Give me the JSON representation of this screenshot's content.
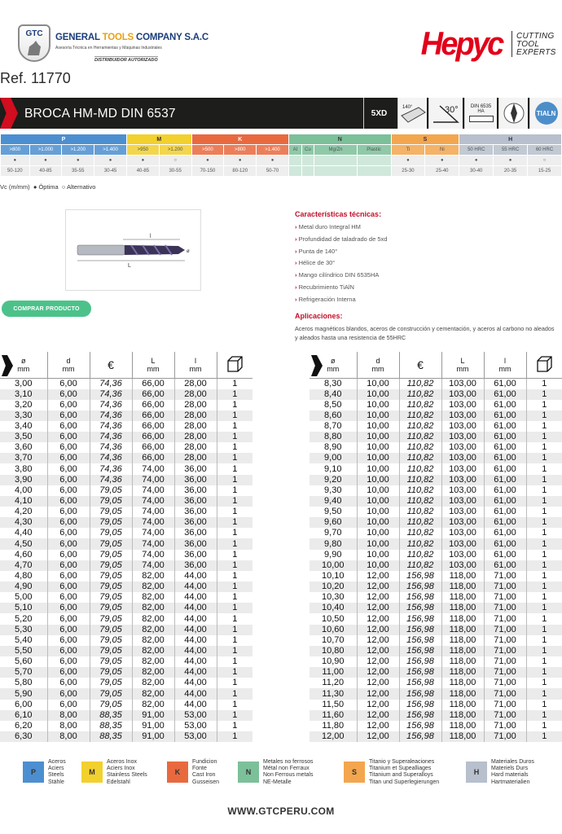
{
  "header": {
    "company_logo_text": "GTC",
    "company_name_a": "GENERAL",
    "company_name_b": "TOOLS",
    "company_name_c": "COMPANY S.A.C",
    "company_sub": "Asesoría Técnica en Herramientas y Máquinas Industriales",
    "distributor": "DISTRIBUIDOR AUTORIZADO",
    "brand": "Hepyc",
    "brand_tag": [
      "CUTTING",
      "TOOL",
      "EXPERTS"
    ],
    "ref": "Ref. 11770"
  },
  "product": {
    "title": "BROCA HM-MD DIN 6537",
    "icons": {
      "depth": "5XD",
      "point": "140°",
      "helix": "30°",
      "shank": "DIN 6535 HA",
      "coating": "TIALN"
    }
  },
  "materials": {
    "groups": [
      {
        "label": "P",
        "span": 4,
        "color": "#4c8fd0"
      },
      {
        "label": "M",
        "span": 2,
        "color": "#f2d02e"
      },
      {
        "label": "K",
        "span": 3,
        "color": "#e9693f"
      },
      {
        "label": "N",
        "span": 4,
        "color": "#7cc09a"
      },
      {
        "label": "S",
        "span": 2,
        "color": "#f3a64e"
      },
      {
        "label": "H",
        "span": 3,
        "color": "#b7c0cc"
      }
    ],
    "sub": [
      ">800",
      ">1.000",
      ">1.200",
      ">1.400",
      ">950",
      ">1.200",
      ">500",
      ">800",
      ">1.400",
      "Al",
      "Cu",
      "Mg/Zn",
      "Plastic",
      "Ti",
      "Ni",
      "50 HRC",
      "55 HRC",
      "60 HRC"
    ],
    "marks": [
      "●",
      "●",
      "●",
      "●",
      "●",
      "○",
      "●",
      "●",
      "●",
      "",
      "",
      "",
      "",
      "●",
      "●",
      "●",
      "●",
      "○"
    ],
    "speeds": [
      "50-120",
      "40-85",
      "35-55",
      "30-45",
      "40-85",
      "30-55",
      "70-150",
      "80-120",
      "50-70",
      "",
      "",
      "",
      "",
      "25-30",
      "25-40",
      "30-40",
      "20-35",
      "15-25"
    ]
  },
  "vc_legend": {
    "vc": "Vc (m/mm)",
    "opt": "Óptima",
    "alt": "Alternativo"
  },
  "drawing": {
    "l_small": "l",
    "l_big": "L",
    "d": "ø"
  },
  "buy_button": "COMPRAR PRODUCTO",
  "features": {
    "heading": "Características técnicas:",
    "items": [
      "Metal duro Integral HM",
      "Profundidad de taladrado de 5xd",
      "Punta de 140°",
      "Hélice de 30°",
      "Mango cilíndrico DIN 6535HA",
      "Recubrimiento TiAlN",
      "Refrigeración Interna"
    ]
  },
  "applications": {
    "heading": "Aplicaciones:",
    "text": "Aceros magnéticos blandos, aceros de construcción y cementación, y aceros al carbono no aleados y aleados hasta una resistencia de 55HRC"
  },
  "table": {
    "headers": [
      {
        "top": "ø",
        "bottom": "mm"
      },
      {
        "top": "d",
        "bottom": "mm"
      },
      {
        "top": "€",
        "bottom": ""
      },
      {
        "top": "L",
        "bottom": "mm"
      },
      {
        "top": "l",
        "bottom": "mm"
      }
    ],
    "left": [
      [
        "3,00",
        "6,00",
        "74,36",
        "66,00",
        "28,00",
        "1"
      ],
      [
        "3,10",
        "6,00",
        "74,36",
        "66,00",
        "28,00",
        "1"
      ],
      [
        "3,20",
        "6,00",
        "74,36",
        "66,00",
        "28,00",
        "1"
      ],
      [
        "3,30",
        "6,00",
        "74,36",
        "66,00",
        "28,00",
        "1"
      ],
      [
        "3,40",
        "6,00",
        "74,36",
        "66,00",
        "28,00",
        "1"
      ],
      [
        "3,50",
        "6,00",
        "74,36",
        "66,00",
        "28,00",
        "1"
      ],
      [
        "3,60",
        "6,00",
        "74,36",
        "66,00",
        "28,00",
        "1"
      ],
      [
        "3,70",
        "6,00",
        "74,36",
        "66,00",
        "28,00",
        "1"
      ],
      [
        "3,80",
        "6,00",
        "74,36",
        "74,00",
        "36,00",
        "1"
      ],
      [
        "3,90",
        "6,00",
        "74,36",
        "74,00",
        "36,00",
        "1"
      ],
      [
        "4,00",
        "6,00",
        "79,05",
        "74,00",
        "36,00",
        "1"
      ],
      [
        "4,10",
        "6,00",
        "79,05",
        "74,00",
        "36,00",
        "1"
      ],
      [
        "4,20",
        "6,00",
        "79,05",
        "74,00",
        "36,00",
        "1"
      ],
      [
        "4,30",
        "6,00",
        "79,05",
        "74,00",
        "36,00",
        "1"
      ],
      [
        "4,40",
        "6,00",
        "79,05",
        "74,00",
        "36,00",
        "1"
      ],
      [
        "4,50",
        "6,00",
        "79,05",
        "74,00",
        "36,00",
        "1"
      ],
      [
        "4,60",
        "6,00",
        "79,05",
        "74,00",
        "36,00",
        "1"
      ],
      [
        "4,70",
        "6,00",
        "79,05",
        "74,00",
        "36,00",
        "1"
      ],
      [
        "4,80",
        "6,00",
        "79,05",
        "82,00",
        "44,00",
        "1"
      ],
      [
        "4,90",
        "6,00",
        "79,05",
        "82,00",
        "44,00",
        "1"
      ],
      [
        "5,00",
        "6,00",
        "79,05",
        "82,00",
        "44,00",
        "1"
      ],
      [
        "5,10",
        "6,00",
        "79,05",
        "82,00",
        "44,00",
        "1"
      ],
      [
        "5,20",
        "6,00",
        "79,05",
        "82,00",
        "44,00",
        "1"
      ],
      [
        "5,30",
        "6,00",
        "79,05",
        "82,00",
        "44,00",
        "1"
      ],
      [
        "5,40",
        "6,00",
        "79,05",
        "82,00",
        "44,00",
        "1"
      ],
      [
        "5,50",
        "6,00",
        "79,05",
        "82,00",
        "44,00",
        "1"
      ],
      [
        "5,60",
        "6,00",
        "79,05",
        "82,00",
        "44,00",
        "1"
      ],
      [
        "5,70",
        "6,00",
        "79,05",
        "82,00",
        "44,00",
        "1"
      ],
      [
        "5,80",
        "6,00",
        "79,05",
        "82,00",
        "44,00",
        "1"
      ],
      [
        "5,90",
        "6,00",
        "79,05",
        "82,00",
        "44,00",
        "1"
      ],
      [
        "6,00",
        "6,00",
        "79,05",
        "82,00",
        "44,00",
        "1"
      ],
      [
        "6,10",
        "8,00",
        "88,35",
        "91,00",
        "53,00",
        "1"
      ],
      [
        "6,20",
        "8,00",
        "88,35",
        "91,00",
        "53,00",
        "1"
      ],
      [
        "6,30",
        "8,00",
        "88,35",
        "91,00",
        "53,00",
        "1"
      ]
    ],
    "right": [
      [
        "8,30",
        "10,00",
        "110,82",
        "103,00",
        "61,00",
        "1"
      ],
      [
        "8,40",
        "10,00",
        "110,82",
        "103,00",
        "61,00",
        "1"
      ],
      [
        "8,50",
        "10,00",
        "110,82",
        "103,00",
        "61,00",
        "1"
      ],
      [
        "8,60",
        "10,00",
        "110,82",
        "103,00",
        "61,00",
        "1"
      ],
      [
        "8,70",
        "10,00",
        "110,82",
        "103,00",
        "61,00",
        "1"
      ],
      [
        "8,80",
        "10,00",
        "110,82",
        "103,00",
        "61,00",
        "1"
      ],
      [
        "8,90",
        "10,00",
        "110,82",
        "103,00",
        "61,00",
        "1"
      ],
      [
        "9,00",
        "10,00",
        "110,82",
        "103,00",
        "61,00",
        "1"
      ],
      [
        "9,10",
        "10,00",
        "110,82",
        "103,00",
        "61,00",
        "1"
      ],
      [
        "9,20",
        "10,00",
        "110,82",
        "103,00",
        "61,00",
        "1"
      ],
      [
        "9,30",
        "10,00",
        "110,82",
        "103,00",
        "61,00",
        "1"
      ],
      [
        "9,40",
        "10,00",
        "110,82",
        "103,00",
        "61,00",
        "1"
      ],
      [
        "9,50",
        "10,00",
        "110,82",
        "103,00",
        "61,00",
        "1"
      ],
      [
        "9,60",
        "10,00",
        "110,82",
        "103,00",
        "61,00",
        "1"
      ],
      [
        "9,70",
        "10,00",
        "110,82",
        "103,00",
        "61,00",
        "1"
      ],
      [
        "9,80",
        "10,00",
        "110,82",
        "103,00",
        "61,00",
        "1"
      ],
      [
        "9,90",
        "10,00",
        "110,82",
        "103,00",
        "61,00",
        "1"
      ],
      [
        "10,00",
        "10,00",
        "110,82",
        "103,00",
        "61,00",
        "1"
      ],
      [
        "10,10",
        "12,00",
        "156,98",
        "118,00",
        "71,00",
        "1"
      ],
      [
        "10,20",
        "12,00",
        "156,98",
        "118,00",
        "71,00",
        "1"
      ],
      [
        "10,30",
        "12,00",
        "156,98",
        "118,00",
        "71,00",
        "1"
      ],
      [
        "10,40",
        "12,00",
        "156,98",
        "118,00",
        "71,00",
        "1"
      ],
      [
        "10,50",
        "12,00",
        "156,98",
        "118,00",
        "71,00",
        "1"
      ],
      [
        "10,60",
        "12,00",
        "156,98",
        "118,00",
        "71,00",
        "1"
      ],
      [
        "10,70",
        "12,00",
        "156,98",
        "118,00",
        "71,00",
        "1"
      ],
      [
        "10,80",
        "12,00",
        "156,98",
        "118,00",
        "71,00",
        "1"
      ],
      [
        "10,90",
        "12,00",
        "156,98",
        "118,00",
        "71,00",
        "1"
      ],
      [
        "11,00",
        "12,00",
        "156,98",
        "118,00",
        "71,00",
        "1"
      ],
      [
        "11,20",
        "12,00",
        "156,98",
        "118,00",
        "71,00",
        "1"
      ],
      [
        "11,30",
        "12,00",
        "156,98",
        "118,00",
        "71,00",
        "1"
      ],
      [
        "11,50",
        "12,00",
        "156,98",
        "118,00",
        "71,00",
        "1"
      ],
      [
        "11,60",
        "12,00",
        "156,98",
        "118,00",
        "71,00",
        "1"
      ],
      [
        "11,80",
        "12,00",
        "156,98",
        "118,00",
        "71,00",
        "1"
      ],
      [
        "12,00",
        "12,00",
        "156,98",
        "118,00",
        "71,00",
        "1"
      ]
    ]
  },
  "legend": [
    {
      "key": "P",
      "color": "#4c8fd0",
      "lines": [
        "Aceros",
        "Aciers",
        "Steels",
        "Stähle"
      ]
    },
    {
      "key": "M",
      "color": "#f2d02e",
      "lines": [
        "Aceros Inox",
        "Aciers Inox",
        "Stainless Steels",
        "Edelstahl"
      ]
    },
    {
      "key": "K",
      "color": "#e9693f",
      "lines": [
        "Fundicion",
        "Fonte",
        "Cast Iron",
        "Gusseisen"
      ]
    },
    {
      "key": "N",
      "color": "#7cc09a",
      "lines": [
        "Metales no ferrosos",
        "Métal non Ferraux",
        "Non Ferrous metals",
        "NE-Metalle"
      ]
    },
    {
      "key": "S",
      "color": "#f3a64e",
      "lines": [
        "Titanio y Superaleaciones",
        "Titanium et Supealliages",
        "Titanium and Superalloys",
        "Titan und Superlegierungen"
      ]
    },
    {
      "key": "H",
      "color": "#b7c0cc",
      "lines": [
        "Materiales Duros",
        "Materiels Durs",
        "Hard materials",
        "Hartmaterialien"
      ]
    }
  ],
  "footer_url": "WWW.GTCPERU.COM"
}
